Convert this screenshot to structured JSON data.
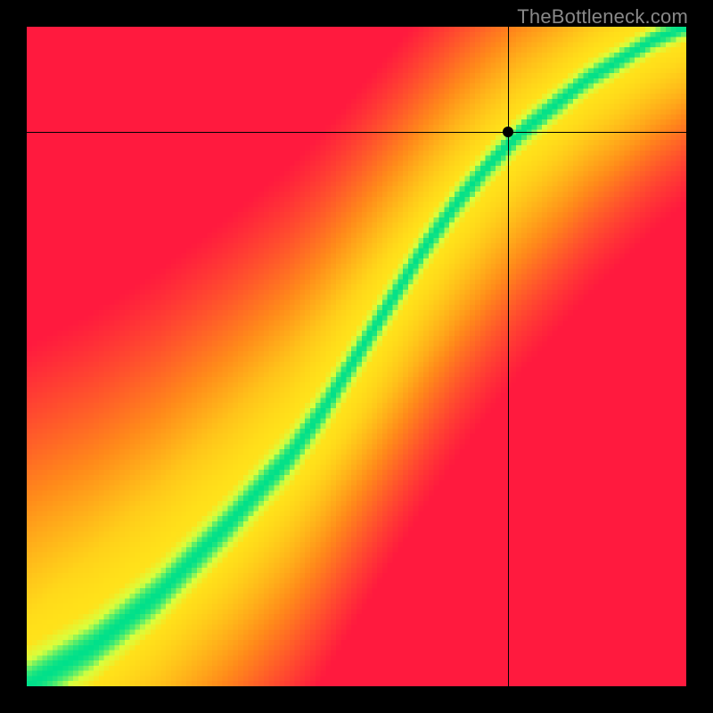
{
  "watermark": "TheBottleneck.com",
  "chart_data": {
    "type": "heatmap",
    "title": "",
    "xlabel": "",
    "ylabel": "",
    "xlim": [
      0,
      100
    ],
    "ylim": [
      0,
      100
    ],
    "grid": false,
    "legend": false,
    "crosshair": {
      "x": 73,
      "y": 84
    },
    "marker": {
      "x": 73,
      "y": 84
    },
    "optimal_ridge": [
      {
        "x": 0,
        "y": 0
      },
      {
        "x": 10,
        "y": 6
      },
      {
        "x": 20,
        "y": 14
      },
      {
        "x": 30,
        "y": 24
      },
      {
        "x": 40,
        "y": 35
      },
      {
        "x": 45,
        "y": 42
      },
      {
        "x": 50,
        "y": 50
      },
      {
        "x": 55,
        "y": 58
      },
      {
        "x": 60,
        "y": 66
      },
      {
        "x": 65,
        "y": 73
      },
      {
        "x": 70,
        "y": 79
      },
      {
        "x": 75,
        "y": 84
      },
      {
        "x": 80,
        "y": 88
      },
      {
        "x": 85,
        "y": 92
      },
      {
        "x": 90,
        "y": 95
      },
      {
        "x": 95,
        "y": 98
      },
      {
        "x": 100,
        "y": 100
      }
    ],
    "colorscale": [
      {
        "stop": 0.0,
        "color": "#ff1a3e"
      },
      {
        "stop": 0.4,
        "color": "#ff8a1a"
      },
      {
        "stop": 0.7,
        "color": "#ffe11a"
      },
      {
        "stop": 0.88,
        "color": "#d8ff3e"
      },
      {
        "stop": 1.0,
        "color": "#00e08a"
      }
    ],
    "pixelation": 128
  }
}
